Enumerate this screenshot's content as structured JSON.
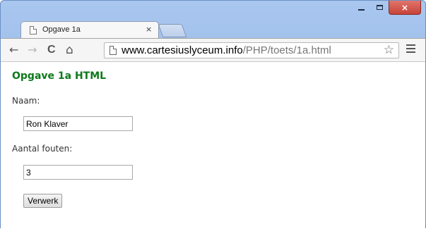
{
  "browser": {
    "tab": {
      "title": "Opgave 1a",
      "close_glyph": "×"
    },
    "window_controls": {
      "close_glyph": "×"
    },
    "address": {
      "host": "www.cartesiuslyceum.info",
      "path": "/PHP/toets/1a.html"
    },
    "nav": {
      "back": "←",
      "forward": "→",
      "reload": "C",
      "home": "⌂",
      "bookmark": "☆"
    }
  },
  "page": {
    "title": "Opgave 1a HTML",
    "form": {
      "name_label": "Naam:",
      "name_value": "Ron Klaver",
      "errors_label": "Aantal fouten:",
      "errors_value": "3",
      "submit_label": "Verwerk"
    }
  },
  "colors": {
    "title_green": "#0b7a1a",
    "close_red": "#c7433a"
  },
  "icons": [
    "page-icon",
    "back-icon",
    "forward-icon",
    "reload-icon",
    "home-icon",
    "star-icon",
    "menu-icon",
    "minimize-icon",
    "maximize-icon",
    "close-icon"
  ]
}
